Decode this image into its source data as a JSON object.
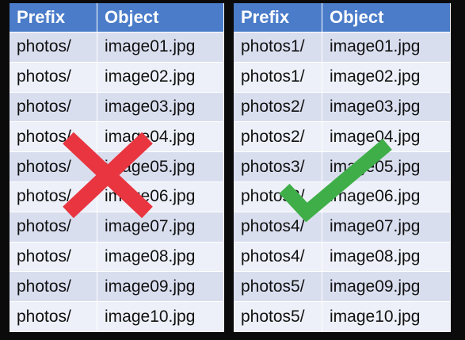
{
  "tables": [
    {
      "headers": [
        "Prefix",
        "Object"
      ],
      "rows": [
        [
          "photos/",
          "image01.jpg"
        ],
        [
          "photos/",
          "image02.jpg"
        ],
        [
          "photos/",
          "image03.jpg"
        ],
        [
          "photos/",
          "image04.jpg"
        ],
        [
          "photos/",
          "image05.jpg"
        ],
        [
          "photos/",
          "image06.jpg"
        ],
        [
          "photos/",
          "image07.jpg"
        ],
        [
          "photos/",
          "image08.jpg"
        ],
        [
          "photos/",
          "image09.jpg"
        ],
        [
          "photos/",
          "image10.jpg"
        ]
      ]
    },
    {
      "headers": [
        "Prefix",
        "Object"
      ],
      "rows": [
        [
          "photos1/",
          "image01.jpg"
        ],
        [
          "photos1/",
          "image02.jpg"
        ],
        [
          "photos2/",
          "image03.jpg"
        ],
        [
          "photos2/",
          "image04.jpg"
        ],
        [
          "photos3/",
          "image05.jpg"
        ],
        [
          "photos3/",
          "image06.jpg"
        ],
        [
          "photos4/",
          "image07.jpg"
        ],
        [
          "photos4/",
          "image08.jpg"
        ],
        [
          "photos5/",
          "image09.jpg"
        ],
        [
          "photos5/",
          "image10.jpg"
        ]
      ]
    }
  ],
  "marks": {
    "left": "cross-mark-icon",
    "right": "check-mark-icon"
  },
  "colors": {
    "header": "#4a7cc9",
    "row_dark": "#d9deef",
    "row_light": "#edf0f8",
    "cross": "#e8353f",
    "check": "#3fae49",
    "background": "#0b0b0b"
  }
}
